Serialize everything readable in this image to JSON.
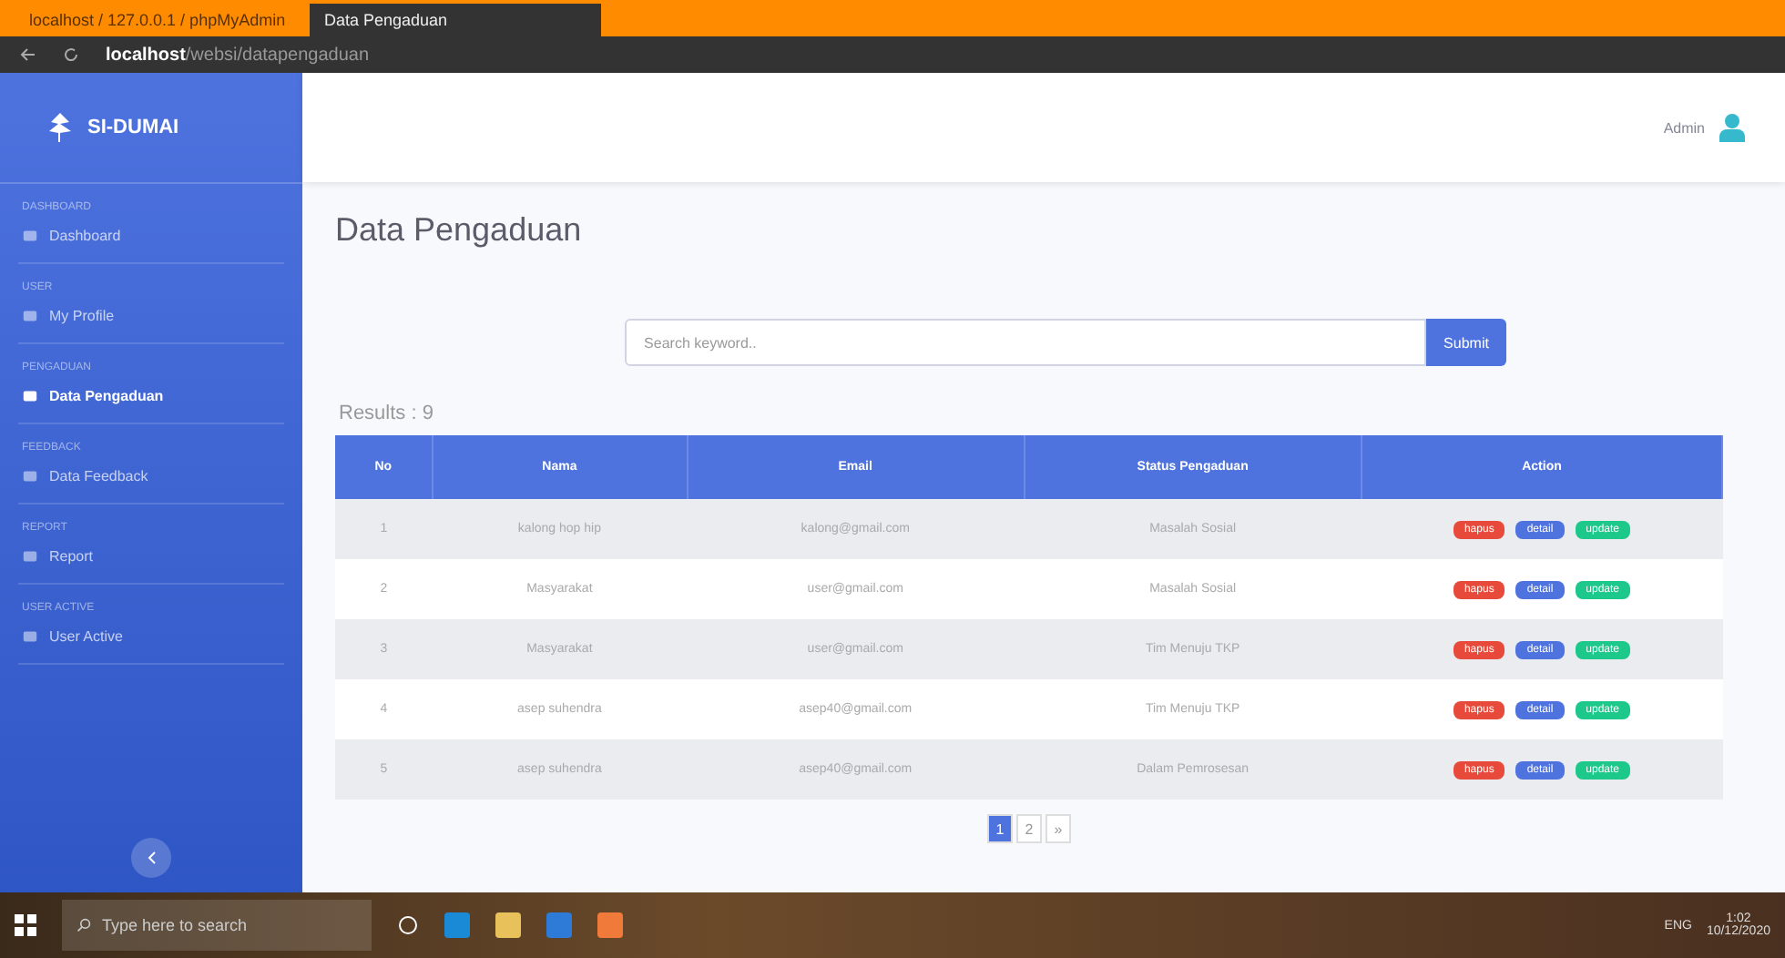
{
  "browser": {
    "tabs": [
      {
        "label": "localhost / 127.0.0.1 / phpMyAdmin",
        "selected": false
      },
      {
        "label": "Data Pengaduan",
        "selected": true
      }
    ],
    "url_host": "localhost",
    "url_path": "/websi/datapengaduan"
  },
  "sidebar": {
    "brand": "SI-DUMAI",
    "items": [
      {
        "heading": "DASHBOARD",
        "label": "Dashboard",
        "selected": false
      },
      {
        "heading": "USER",
        "label": "My Profile",
        "selected": false
      },
      {
        "heading": "PENGADUAN",
        "label": "Data Pengaduan",
        "selected": true
      },
      {
        "heading": "FEEDBACK",
        "label": "Data Feedback",
        "selected": false
      },
      {
        "heading": "REPORT",
        "label": "Report",
        "selected": false
      },
      {
        "heading": "USER ACTIVE",
        "label": "User Active",
        "selected": false
      }
    ]
  },
  "topbar": {
    "user": "Admin"
  },
  "page_title": "Data Pengaduan",
  "search": {
    "placeholder": "Search keyword..",
    "button": "Submit"
  },
  "results": "Results : 9",
  "table": {
    "columns": [
      "No",
      "Nama",
      "Email",
      "Status Pengaduan",
      "Action"
    ],
    "rows": [
      {
        "cells": [
          "1",
          "kalong hop hip",
          "kalong@gmail.com",
          "Masalah Sosial"
        ],
        "actions": [
          {
            "label": "hapus",
            "color": "#e74a3b"
          },
          {
            "label": "detail",
            "color": "#4e73df"
          },
          {
            "label": "update",
            "color": "#1cc88a"
          }
        ]
      },
      {
        "cells": [
          "2",
          "Masyarakat",
          "user@gmail.com",
          "Masalah Sosial"
        ],
        "actions": [
          {
            "label": "hapus",
            "color": "#e74a3b"
          },
          {
            "label": "detail",
            "color": "#4e73df"
          },
          {
            "label": "update",
            "color": "#1cc88a"
          }
        ]
      },
      {
        "cells": [
          "3",
          "Masyarakat",
          "user@gmail.com",
          "Tim Menuju TKP"
        ],
        "actions": [
          {
            "label": "hapus",
            "color": "#e74a3b"
          },
          {
            "label": "detail",
            "color": "#4e73df"
          },
          {
            "label": "update",
            "color": "#1cc88a"
          }
        ]
      },
      {
        "cells": [
          "4",
          "asep suhendra",
          "asep40@gmail.com",
          "Tim Menuju TKP"
        ],
        "actions": [
          {
            "label": "hapus",
            "color": "#e74a3b"
          },
          {
            "label": "detail",
            "color": "#4e73df"
          },
          {
            "label": "update",
            "color": "#1cc88a"
          }
        ]
      },
      {
        "cells": [
          "5",
          "asep suhendra",
          "asep40@gmail.com",
          "Dalam Pemrosesan"
        ],
        "actions": [
          {
            "label": "hapus",
            "color": "#e74a3b"
          },
          {
            "label": "detail",
            "color": "#4e73df"
          },
          {
            "label": "update",
            "color": "#1cc88a"
          }
        ]
      }
    ]
  },
  "pagination": [
    {
      "label": "1",
      "selected": true
    },
    {
      "label": "2",
      "selected": false
    },
    {
      "label": "»",
      "selected": false
    }
  ],
  "taskbar": {
    "search_placeholder": "Type here to search",
    "time": "1:02",
    "date": "10/12/2020",
    "lang": "ENG"
  }
}
